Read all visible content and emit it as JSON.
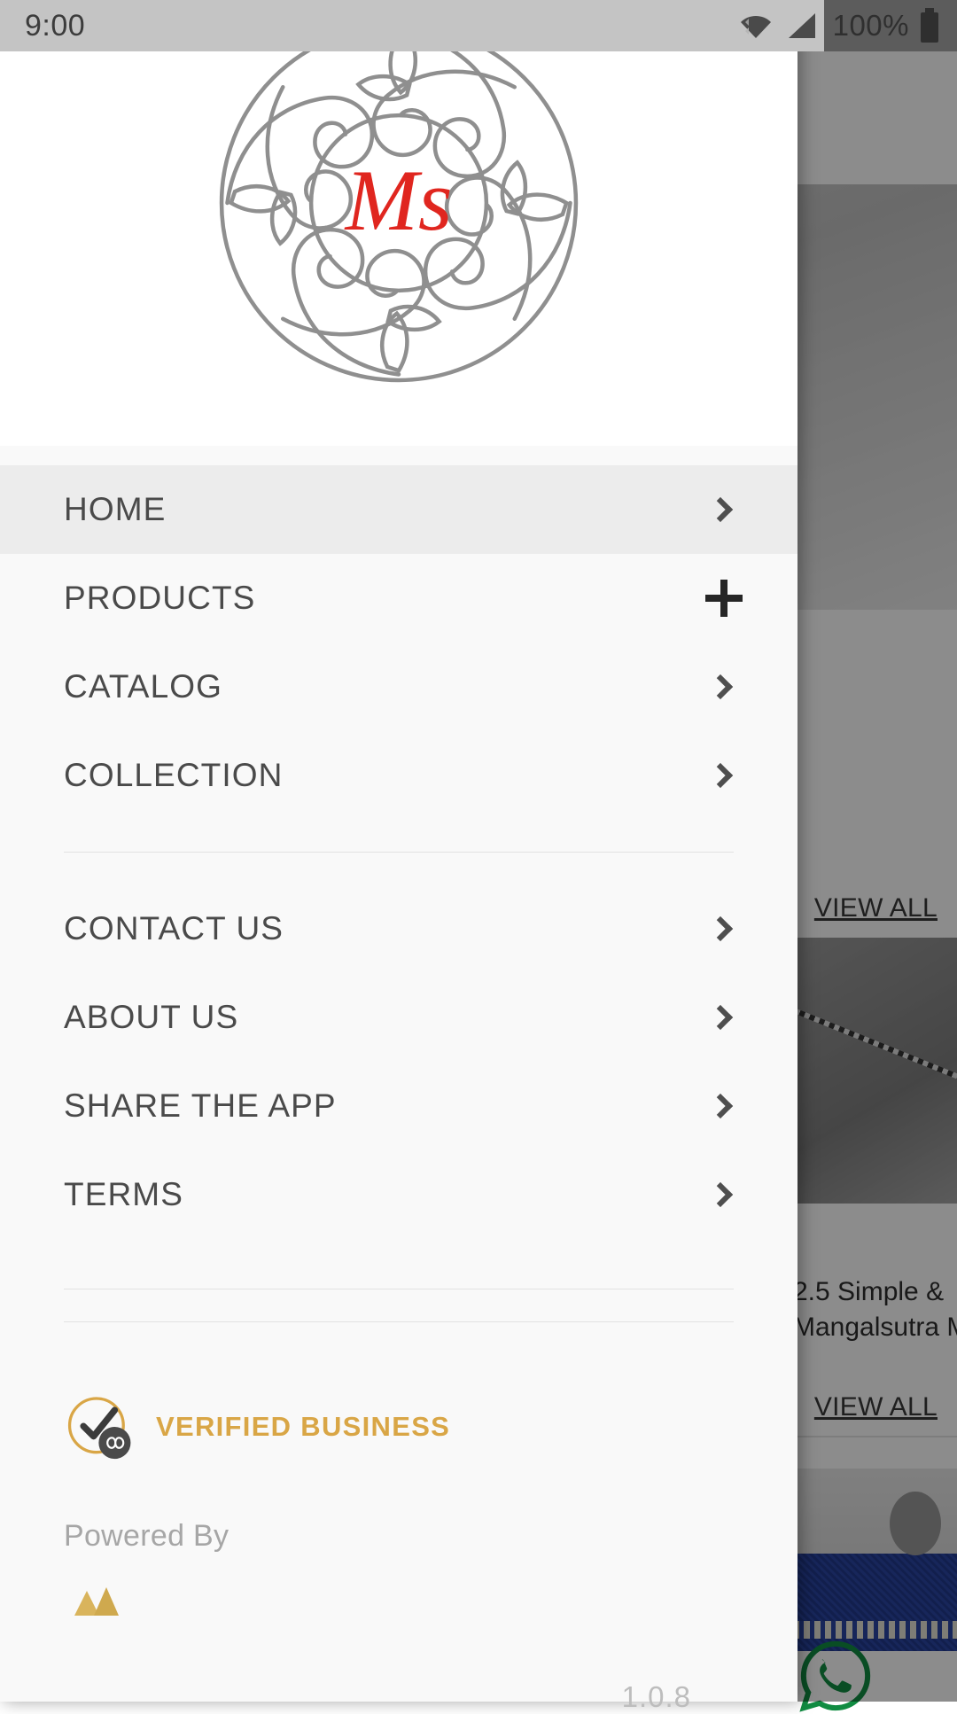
{
  "status_bar": {
    "time": "9:00",
    "battery_percent": "100%",
    "icons": [
      "wifi-icon",
      "cellular-signal-icon",
      "battery-icon"
    ]
  },
  "drawer": {
    "logo": {
      "monogram": "Ms",
      "monogram_color": "#e0261f",
      "ornament_color": "#8f8f8f",
      "alt": "ornamental-circular-logo"
    },
    "menu_primary": [
      {
        "label": "HOME",
        "indicator": "chevron-right-icon",
        "active": true
      },
      {
        "label": "PRODUCTS",
        "indicator": "plus-icon",
        "active": false
      },
      {
        "label": "CATALOG",
        "indicator": "chevron-right-icon",
        "active": false
      },
      {
        "label": "COLLECTION",
        "indicator": "chevron-right-icon",
        "active": false
      }
    ],
    "menu_secondary": [
      {
        "label": "CONTACT US",
        "indicator": "chevron-right-icon"
      },
      {
        "label": "ABOUT US",
        "indicator": "chevron-right-icon"
      },
      {
        "label": "SHARE THE APP",
        "indicator": "chevron-right-icon"
      },
      {
        "label": "TERMS",
        "indicator": "chevron-right-icon"
      }
    ],
    "verified": {
      "label": "VERIFIED BUSINESS",
      "color": "#d9a646",
      "icon": "verified-check-infinity-icon"
    },
    "footer": {
      "powered_by_label": "Powered By",
      "version": "1.0.8"
    }
  },
  "background_app": {
    "view_all_top_label": "VIEW ALL",
    "view_all_bottom_label": "VIEW ALL",
    "product_title_line1": "2.5 Simple &",
    "product_title_line2": "Mangalsutra M",
    "whatsapp_icon": "whatsapp-icon",
    "whatsapp_color": "#118c42"
  },
  "colors": {
    "drawer_bg": "#f9f9f9",
    "active_item_bg": "#ececec",
    "status_bar_bg": "#c4c4c4",
    "menu_text": "#4a4a4a",
    "accent_gold": "#d9a646",
    "logo_red": "#e0261f"
  }
}
